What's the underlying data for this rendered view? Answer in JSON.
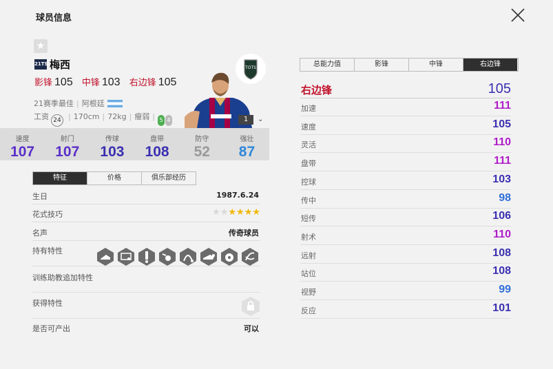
{
  "header": {
    "title": "球员信息"
  },
  "player": {
    "season_badge": "21TS",
    "name": "梅西",
    "positions": [
      {
        "label": "影锋",
        "value": "105"
      },
      {
        "label": "中锋",
        "value": "103"
      },
      {
        "label": "右边锋",
        "value": "105"
      }
    ],
    "season_desc": "21赛季最佳",
    "nation": "阿根廷",
    "wage_label": "工资",
    "wage": "24",
    "height": "170cm",
    "weight": "72kg",
    "build": "瘦弱",
    "foot_strong": "5",
    "foot_weak": "4",
    "card_tag": "TOTS",
    "level": "1"
  },
  "stats": [
    {
      "label": "速度",
      "value": "107",
      "color": "#5b2fc9"
    },
    {
      "label": "射门",
      "value": "107",
      "color": "#5b2fc9"
    },
    {
      "label": "传球",
      "value": "103",
      "color": "#3a2fb0"
    },
    {
      "label": "盘带",
      "value": "108",
      "color": "#3a2fb0"
    },
    {
      "label": "防守",
      "value": "52",
      "color": "#999999"
    },
    {
      "label": "强壮",
      "value": "87",
      "color": "#2f87d9"
    }
  ],
  "left_tabs": [
    "特征",
    "价格",
    "俱乐部经历"
  ],
  "info": {
    "birthday_label": "生日",
    "birthday": "1987.6.24",
    "skill_label": "花式技巧",
    "skill_stars": 4,
    "skill_max": 6,
    "fame_label": "名声",
    "fame": "传奇球员",
    "traits_label": "持有特性",
    "coach_label": "训练助教追加特性",
    "acquire_label": "获得特性",
    "producible_label": "是否可产出",
    "producible": "可以"
  },
  "right_tabs": [
    "总能力值",
    "影锋",
    "中锋",
    "右边锋"
  ],
  "right_active": 3,
  "position_rating": {
    "name": "右边锋",
    "value": "105"
  },
  "attributes": [
    {
      "label": "加速",
      "value": "111",
      "color": "#b01cc9"
    },
    {
      "label": "速度",
      "value": "105",
      "color": "#3a2fb0"
    },
    {
      "label": "灵活",
      "value": "110",
      "color": "#b01cc9"
    },
    {
      "label": "盘带",
      "value": "111",
      "color": "#b01cc9"
    },
    {
      "label": "控球",
      "value": "103",
      "color": "#3a2fb0"
    },
    {
      "label": "传中",
      "value": "98",
      "color": "#2f6fd9"
    },
    {
      "label": "短传",
      "value": "106",
      "color": "#3a2fb0"
    },
    {
      "label": "射术",
      "value": "110",
      "color": "#b01cc9"
    },
    {
      "label": "远射",
      "value": "108",
      "color": "#3a2fb0"
    },
    {
      "label": "站位",
      "value": "108",
      "color": "#3a2fb0"
    },
    {
      "label": "视野",
      "value": "99",
      "color": "#2f6fd9"
    },
    {
      "label": "反应",
      "value": "101",
      "color": "#3a2fb0"
    }
  ]
}
